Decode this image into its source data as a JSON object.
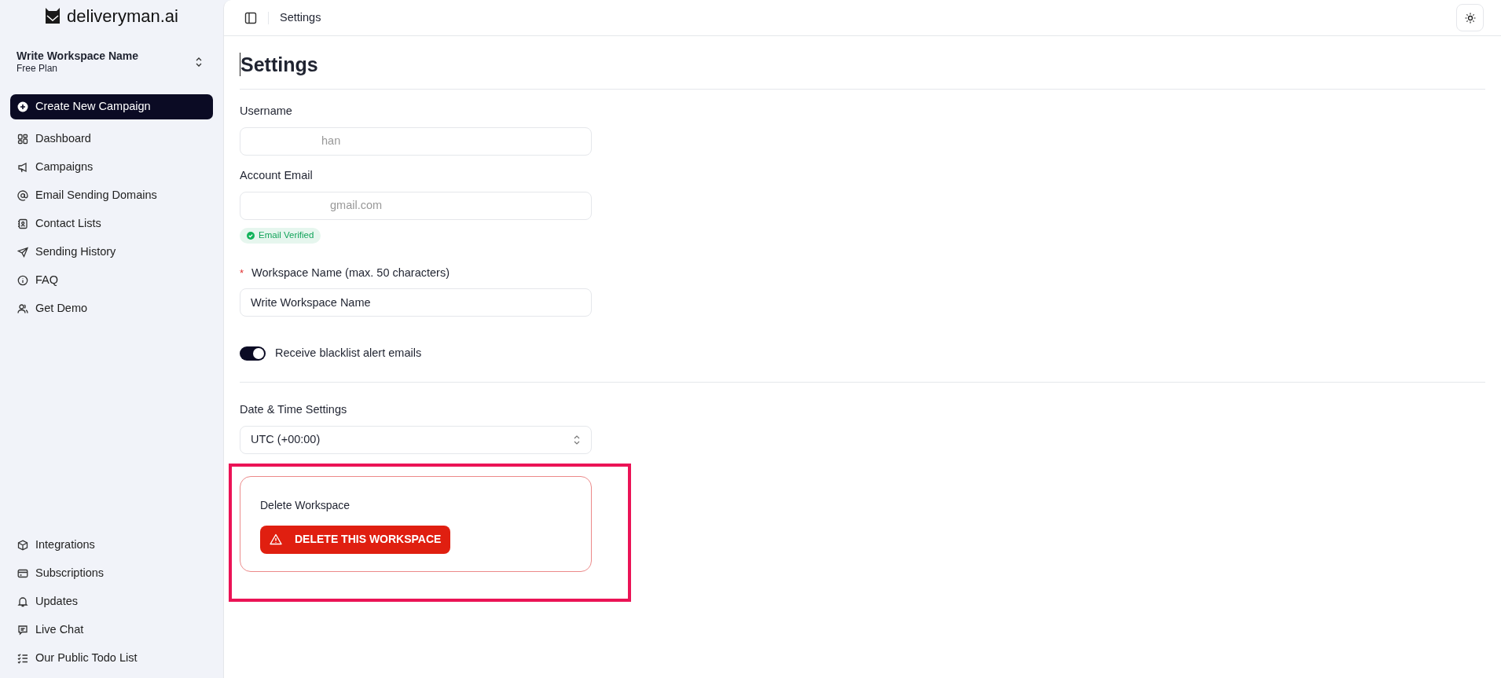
{
  "sidebar": {
    "logo": "deliveryman.ai",
    "workspace": {
      "name": "Write Workspace Name",
      "plan": "Free Plan"
    },
    "create_button": "Create New Campaign",
    "nav_items": [
      {
        "label": "Dashboard"
      },
      {
        "label": "Campaigns"
      },
      {
        "label": "Email Sending Domains"
      },
      {
        "label": "Contact Lists"
      },
      {
        "label": "Sending History"
      },
      {
        "label": "FAQ"
      },
      {
        "label": "Get Demo"
      }
    ],
    "bottom_items": [
      {
        "label": "Integrations"
      },
      {
        "label": "Subscriptions"
      },
      {
        "label": "Updates"
      },
      {
        "label": "Live Chat"
      },
      {
        "label": "Our Public Todo List"
      }
    ]
  },
  "header": {
    "breadcrumb": "Settings"
  },
  "page": {
    "title": "Settings",
    "username": {
      "label": "Username",
      "value": "han"
    },
    "email": {
      "label": "Account Email",
      "value": "gmail.com",
      "badge": "Email Verified"
    },
    "workspace_name": {
      "required_mark": "*",
      "label": "Workspace Name (max. 50 characters)",
      "value": "Write Workspace Name"
    },
    "blacklist_toggle": {
      "label": "Receive blacklist alert emails",
      "on": true
    },
    "timezone": {
      "label": "Date & Time Settings",
      "value": "UTC (+00:00)"
    },
    "danger_zone": {
      "title": "Delete Workspace",
      "button": "DELETE THIS WORKSPACE"
    }
  }
}
